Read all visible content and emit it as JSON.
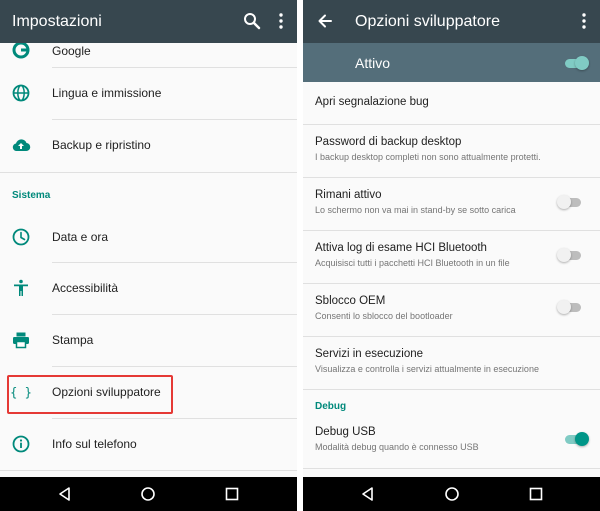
{
  "colors": {
    "appbar": "#37474f",
    "master_bar": "#546e7a",
    "accent": "#00897b",
    "highlight": "#e53935"
  },
  "left": {
    "title": "Impostazioni",
    "toolbar_icons": [
      "search-icon",
      "more-vert-icon"
    ],
    "partial_item": {
      "label": "Google",
      "icon": "google-icon"
    },
    "items": [
      {
        "label": "Lingua e immissione",
        "icon": "globe-icon"
      },
      {
        "label": "Backup e ripristino",
        "icon": "cloud-upload-icon"
      }
    ],
    "section_header": "Sistema",
    "system_items": [
      {
        "label": "Data e ora",
        "icon": "clock-icon"
      },
      {
        "label": "Accessibilità",
        "icon": "accessibility-icon"
      },
      {
        "label": "Stampa",
        "icon": "print-icon"
      },
      {
        "label": "Opzioni sviluppatore",
        "icon": "braces-icon",
        "highlighted": true
      },
      {
        "label": "Info sul telefono",
        "icon": "info-icon"
      }
    ]
  },
  "right": {
    "title": "Opzioni sviluppatore",
    "master_switch_label": "Attivo",
    "master_switch_on": true,
    "prefs": [
      {
        "title": "Apri segnalazione bug",
        "summary": ""
      },
      {
        "title": "Password di backup desktop",
        "summary": "I backup desktop completi non sono attualmente protetti."
      },
      {
        "title": "Rimani attivo",
        "summary": "Lo schermo non va mai in stand-by se sotto carica",
        "switch": "off"
      },
      {
        "title": "Attiva log di esame HCI Bluetooth",
        "summary": "Acquisisci tutti i pacchetti HCI Bluetooth in un file",
        "switch": "off"
      },
      {
        "title": "Sblocco OEM",
        "summary": "Consenti lo sblocco del bootloader",
        "switch": "off"
      },
      {
        "title": "Servizi in esecuzione",
        "summary": "Visualizza e controlla i servizi attualmente in esecuzione"
      }
    ],
    "section_header": "Debug",
    "debug_prefs": [
      {
        "title": "Debug USB",
        "summary": "Modalità debug quando è connesso USB",
        "switch": "on"
      }
    ]
  },
  "navbar": {
    "buttons": [
      "back-icon",
      "home-icon",
      "recents-icon"
    ]
  }
}
